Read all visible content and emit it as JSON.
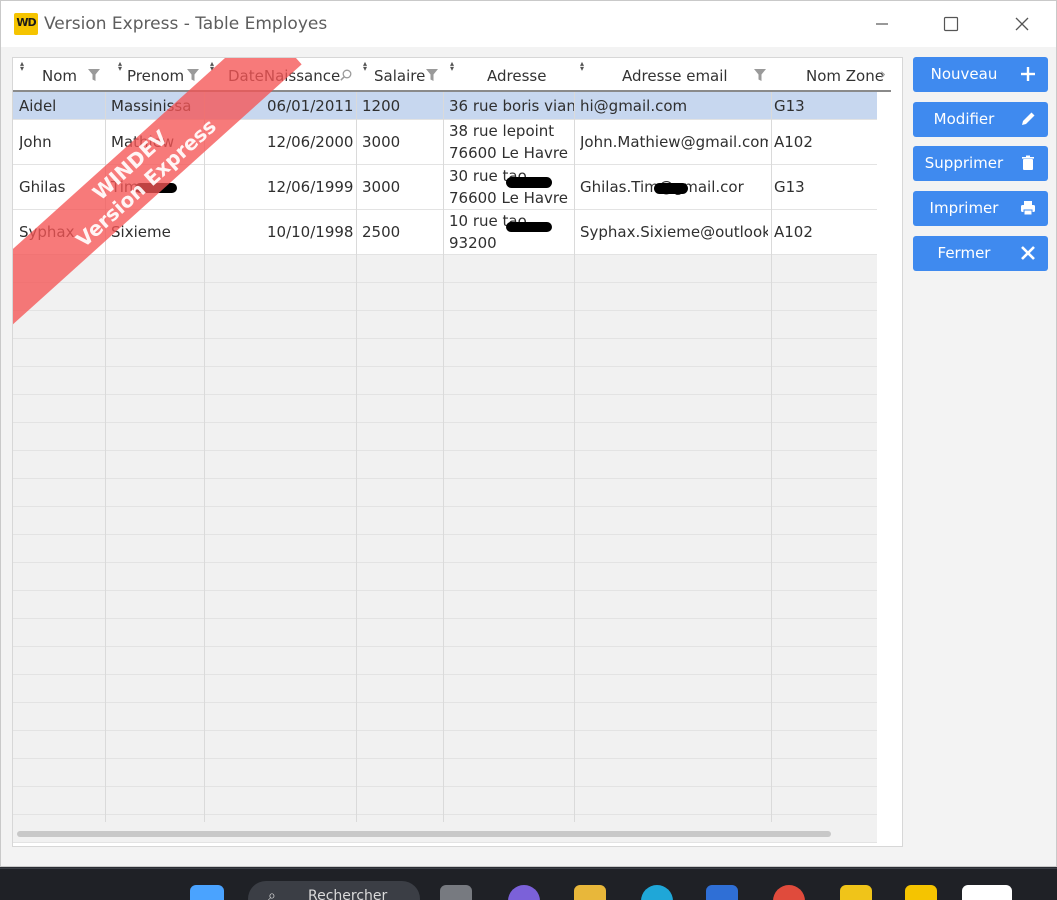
{
  "window": {
    "title": "Version Express - Table Employes",
    "logo_text": "WD"
  },
  "watermark": {
    "line1": "WINDEV",
    "line2": "Version Express"
  },
  "table": {
    "columns": [
      "Nom",
      "Prenom",
      "DateNaissance",
      "Salaire",
      "Adresse",
      "Adresse email",
      "Nom Zone"
    ],
    "rows": [
      {
        "nom": "Aidel",
        "prenom": "Massinissa",
        "date": "06/01/2011",
        "salaire": "1200",
        "adresse1": "36 rue boris vian",
        "adresse2": "",
        "email": "hi@gmail.com",
        "zone": "G13"
      },
      {
        "nom": "John",
        "prenom": "Mathiew",
        "date": "12/06/2000",
        "salaire": "3000",
        "adresse1": "38 rue lepoint",
        "adresse2": "76600 Le Havre",
        "email": "John.Mathiew@gmail.com",
        "zone": "A102"
      },
      {
        "nom": "Ghilas",
        "prenom": "Tim",
        "date": "12/06/1999",
        "salaire": "3000",
        "adresse1": "30 rue tao",
        "adresse2": "76600 Le Havre",
        "email": "Ghilas.Tim@gmail.cor",
        "zone": "G13"
      },
      {
        "nom": "Syphax",
        "prenom": "Sixieme",
        "date": "10/10/1998",
        "salaire": "2500",
        "adresse1": "10 rue tao",
        "adresse2": "93200",
        "email": "Syphax.Sixieme@outlook.f",
        "zone": "A102"
      }
    ],
    "selected_row": 0
  },
  "buttons": {
    "nouveau": "Nouveau",
    "modifier": "Modifier",
    "supprimer": "Supprimer",
    "imprimer": "Imprimer",
    "fermer": "Fermer"
  },
  "taskbar": {
    "search_text": "Rechercher"
  },
  "colors": {
    "button_bg": "#3f8aef",
    "selected_row": "#c7d7ef",
    "watermark": "#f55454",
    "logo": "#f5c400"
  }
}
